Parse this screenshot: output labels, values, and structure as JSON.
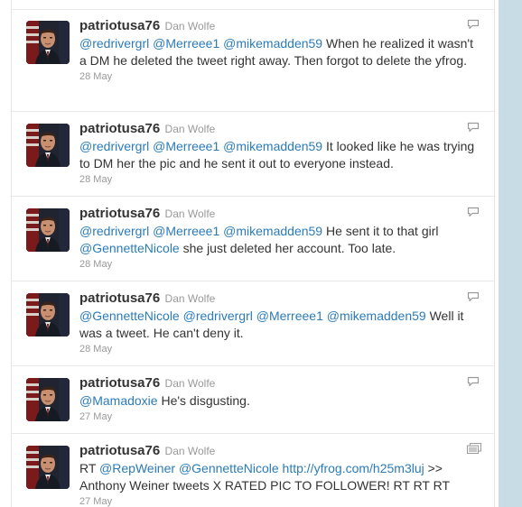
{
  "tweets": [
    {
      "screen_name": "patriotusa76",
      "full_name": "Dan Wolfe",
      "segments": [
        {
          "type": "mention",
          "text": "@redrivergrl"
        },
        {
          "type": "text",
          "text": " "
        },
        {
          "type": "mention",
          "text": "@Merreee1"
        },
        {
          "type": "text",
          "text": " "
        },
        {
          "type": "mention",
          "text": "@mikemadden59"
        },
        {
          "type": "text",
          "text": " When he realized it wasn't a DM he deleted the tweet right away. Then forgot to delete the yfrog."
        }
      ],
      "timestamp": "28 May",
      "action_icon": "reply-icon"
    },
    {
      "screen_name": "patriotusa76",
      "full_name": "Dan Wolfe",
      "segments": [
        {
          "type": "mention",
          "text": "@redrivergrl"
        },
        {
          "type": "text",
          "text": " "
        },
        {
          "type": "mention",
          "text": "@Merreee1"
        },
        {
          "type": "text",
          "text": " "
        },
        {
          "type": "mention",
          "text": "@mikemadden59"
        },
        {
          "type": "text",
          "text": " It looked like he was trying to DM her the pic and he sent it out to everyone instead."
        }
      ],
      "timestamp": "28 May",
      "action_icon": "reply-icon"
    },
    {
      "screen_name": "patriotusa76",
      "full_name": "Dan Wolfe",
      "segments": [
        {
          "type": "mention",
          "text": "@redrivergrl"
        },
        {
          "type": "text",
          "text": " "
        },
        {
          "type": "mention",
          "text": "@Merreee1"
        },
        {
          "type": "text",
          "text": " "
        },
        {
          "type": "mention",
          "text": "@mikemadden59"
        },
        {
          "type": "text",
          "text": " He sent it to that girl "
        },
        {
          "type": "mention",
          "text": "@GennetteNicole"
        },
        {
          "type": "text",
          "text": " she just deleted her account. Too late."
        }
      ],
      "timestamp": "28 May",
      "action_icon": "reply-icon"
    },
    {
      "screen_name": "patriotusa76",
      "full_name": "Dan Wolfe",
      "segments": [
        {
          "type": "mention",
          "text": "@GennetteNicole"
        },
        {
          "type": "text",
          "text": " "
        },
        {
          "type": "mention",
          "text": "@redrivergrl"
        },
        {
          "type": "text",
          "text": " "
        },
        {
          "type": "mention",
          "text": "@Merreee1"
        },
        {
          "type": "text",
          "text": " "
        },
        {
          "type": "mention",
          "text": "@mikemadden59"
        },
        {
          "type": "text",
          "text": " Well it was a tweet. He can't deny it."
        }
      ],
      "timestamp": "28 May",
      "action_icon": "reply-icon"
    },
    {
      "screen_name": "patriotusa76",
      "full_name": "Dan Wolfe",
      "segments": [
        {
          "type": "mention",
          "text": "@Mamadoxie"
        },
        {
          "type": "text",
          "text": " He's disgusting."
        }
      ],
      "timestamp": "27 May",
      "action_icon": "reply-icon"
    },
    {
      "screen_name": "patriotusa76",
      "full_name": "Dan Wolfe",
      "segments": [
        {
          "type": "text",
          "text": "RT "
        },
        {
          "type": "mention",
          "text": "@RepWeiner"
        },
        {
          "type": "text",
          "text": " "
        },
        {
          "type": "mention",
          "text": "@GennetteNicole"
        },
        {
          "type": "text",
          "text": " "
        },
        {
          "type": "link",
          "text": "http://yfrog.com/h25m3luj"
        },
        {
          "type": "text",
          "text": " >> Anthony Weiner tweets X RATED PIC TO FOLLOWER! RT RT RT"
        }
      ],
      "timestamp": "27 May",
      "action_icon": "media-icon"
    }
  ],
  "colors": {
    "link": "#2b7bb9",
    "text": "#333333",
    "muted": "#999999",
    "rail": "#c8dce6"
  }
}
